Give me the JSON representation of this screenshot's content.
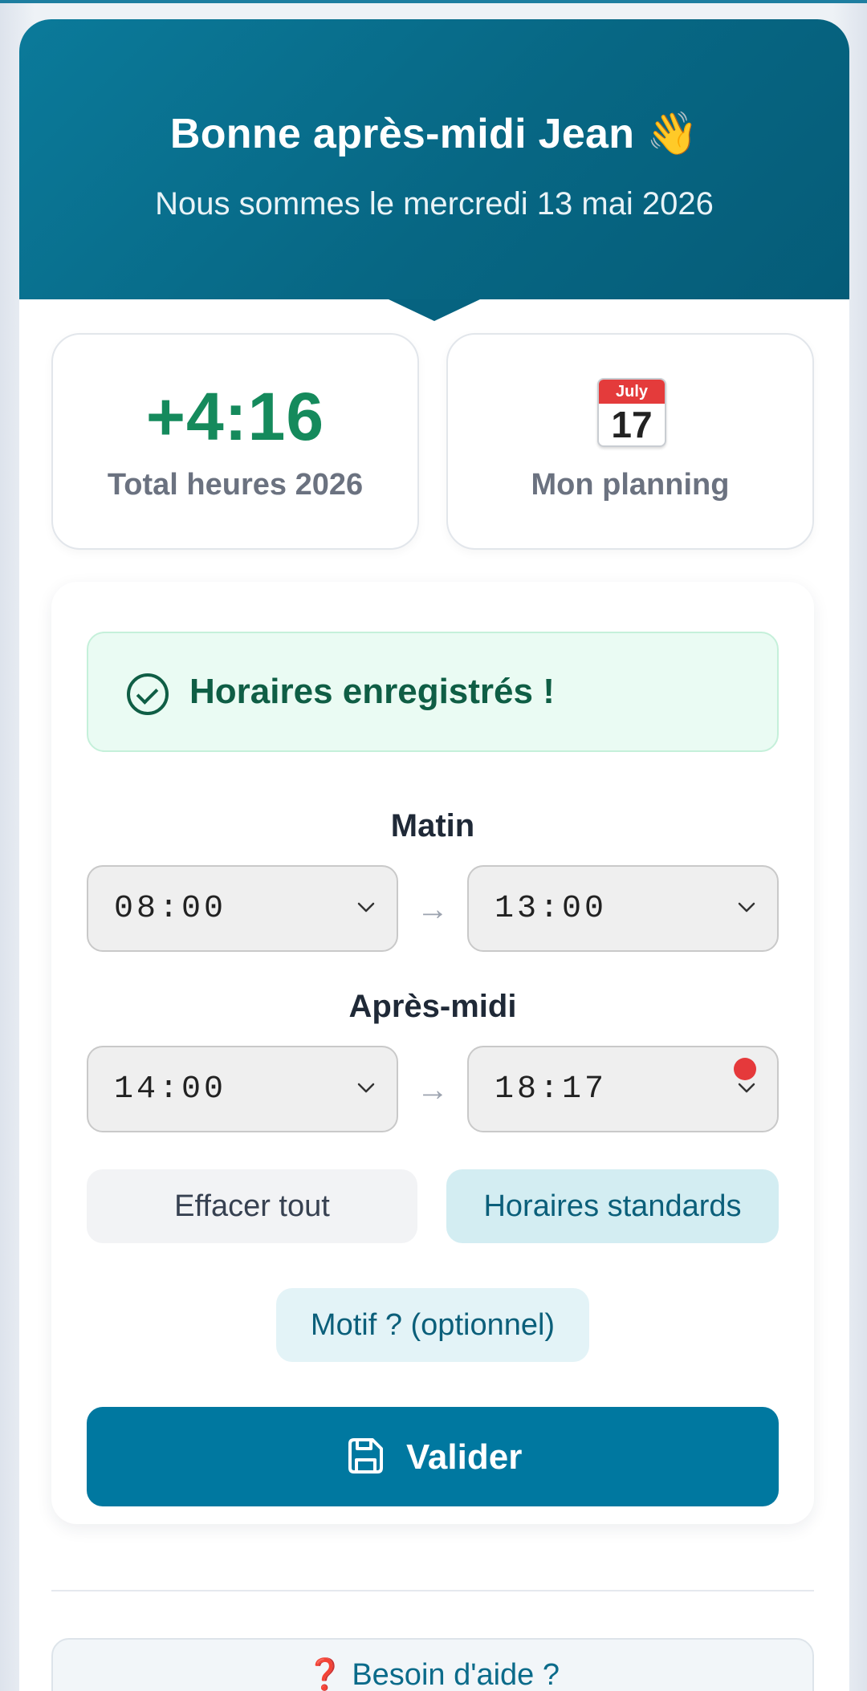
{
  "header": {
    "greeting": "Bonne après-midi Jean",
    "greeting_emoji": "👋",
    "date_line": "Nous sommes le mercredi 13 mai 2026"
  },
  "stats": {
    "total_value": "+4:16",
    "total_label": "Total heures 2026",
    "planning_label": "Mon planning",
    "calendar_month": "July",
    "calendar_day": "17"
  },
  "form": {
    "success_message": "Horaires enregistrés !",
    "morning": {
      "title": "Matin",
      "start": "08:00",
      "end": "13:00"
    },
    "afternoon": {
      "title": "Après-midi",
      "start": "14:00",
      "end": "18:17"
    },
    "arrow": "→",
    "clear_label": "Effacer tout",
    "standard_label": "Horaires standards",
    "reason_label": "Motif ? (optionnel)",
    "validate_label": "Valider"
  },
  "help": {
    "icon": "❓",
    "label": "Besoin d'aide ?"
  },
  "colors": {
    "primary": "#0078a0",
    "header_bg": "#076784",
    "positive": "#158a5c",
    "success_text": "#0f5e45",
    "success_bg": "#eafbf3",
    "alert_dot": "#e5393b"
  }
}
